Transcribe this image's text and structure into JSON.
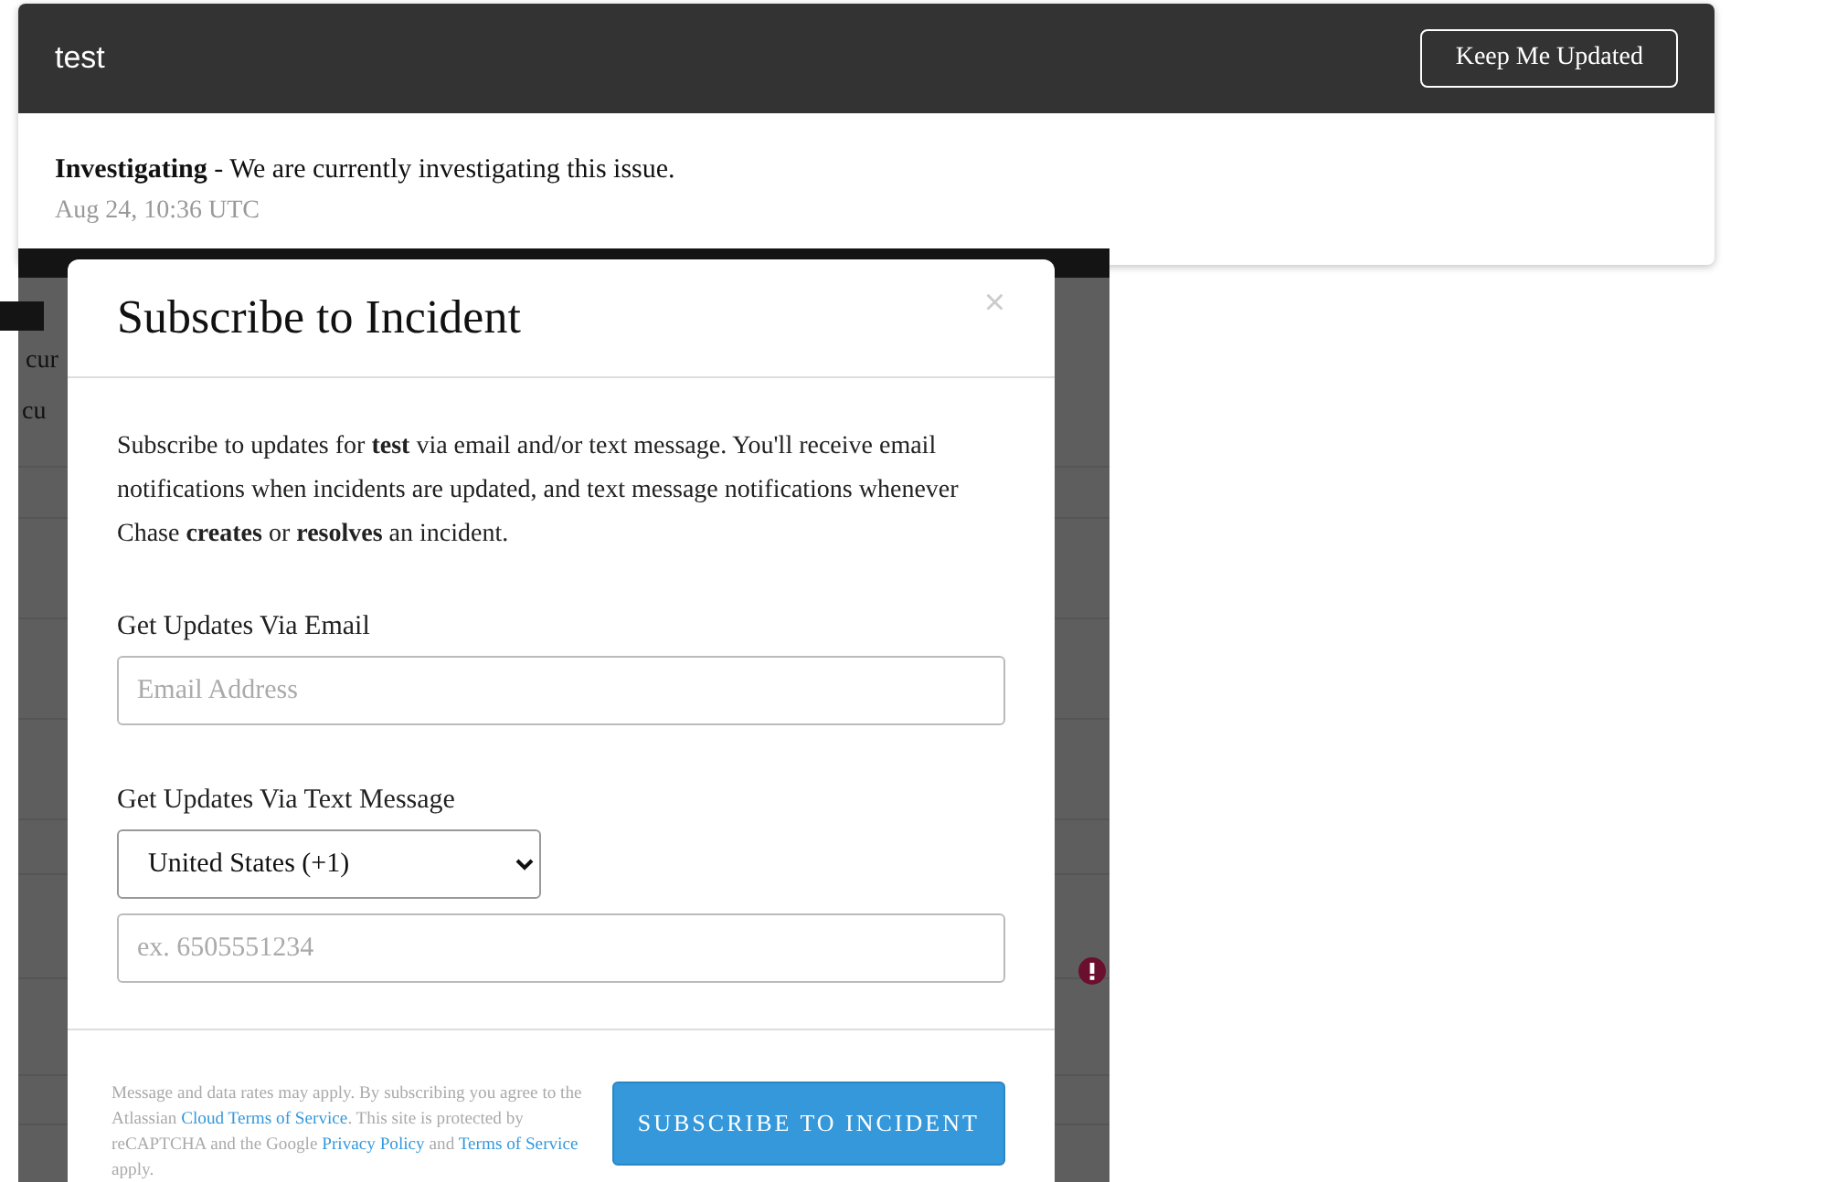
{
  "incident": {
    "title": "test",
    "button": "Keep Me Updated",
    "status": "Investigating",
    "message": " - We are currently investigating this issue.",
    "time": "Aug 24, 10:36 UTC"
  },
  "background_fragments": [
    "cur",
    "cu"
  ],
  "modal": {
    "title": "Subscribe to Incident",
    "close": "×",
    "intro": "Subscribe to updates for **test** via email and/or text message. You'll receive email notifications when incidents are updated, and text message notifications whenever Chase **creates** or **resolves** an incident.",
    "email_label": "Get Updates Via Email",
    "email": {
      "placeholder": "Email Address"
    },
    "sms_label": "Get Updates Via Text Message",
    "country": "United States (+1)",
    "phone": {
      "placeholder": "ex. 6505551234"
    },
    "footer": [
      {
        "kind": "text",
        "text": "Message and data rates may apply. By subscribing you agree to the Atlassian "
      },
      {
        "kind": "link",
        "text": "Cloud Terms of Service"
      },
      {
        "kind": "text",
        "text": ". This site is protected by reCAPTCHA and the Google "
      },
      {
        "kind": "link",
        "text": "Privacy Policy"
      },
      {
        "kind": "text",
        "text": " and "
      },
      {
        "kind": "link",
        "text": "Terms of Service"
      },
      {
        "kind": "text",
        "text": " apply."
      }
    ],
    "submit": "SUBSCRIBE TO INCIDENT"
  }
}
